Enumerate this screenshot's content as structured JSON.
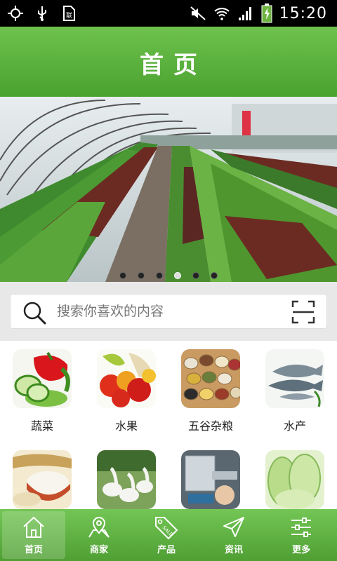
{
  "status_bar": {
    "time": "15:20",
    "icons": [
      "gps-icon",
      "usb-icon",
      "sim-card-icon",
      "mute-icon",
      "wifi-icon",
      "signal-icon",
      "battery-charging-icon"
    ]
  },
  "header": {
    "title": "首页"
  },
  "banner": {
    "slide_count": 6,
    "active_index": 3
  },
  "search": {
    "placeholder": "搜索你喜欢的内容",
    "scan_icon": "scan-icon"
  },
  "categories": [
    {
      "label": "蔬菜"
    },
    {
      "label": "水果"
    },
    {
      "label": "五谷杂粮"
    },
    {
      "label": "水产"
    },
    {
      "label": ""
    },
    {
      "label": ""
    },
    {
      "label": ""
    },
    {
      "label": ""
    }
  ],
  "tabs": [
    {
      "label": "首页",
      "icon": "home-icon",
      "active": true
    },
    {
      "label": "商家",
      "icon": "map-pin-icon",
      "active": false
    },
    {
      "label": "产品",
      "icon": "sale-tag-icon",
      "active": false
    },
    {
      "label": "资讯",
      "icon": "paper-plane-icon",
      "active": false
    },
    {
      "label": "更多",
      "icon": "sliders-icon",
      "active": false
    }
  ],
  "colors": {
    "brand_green": "#5ab53b",
    "status_bar": "#000000"
  }
}
